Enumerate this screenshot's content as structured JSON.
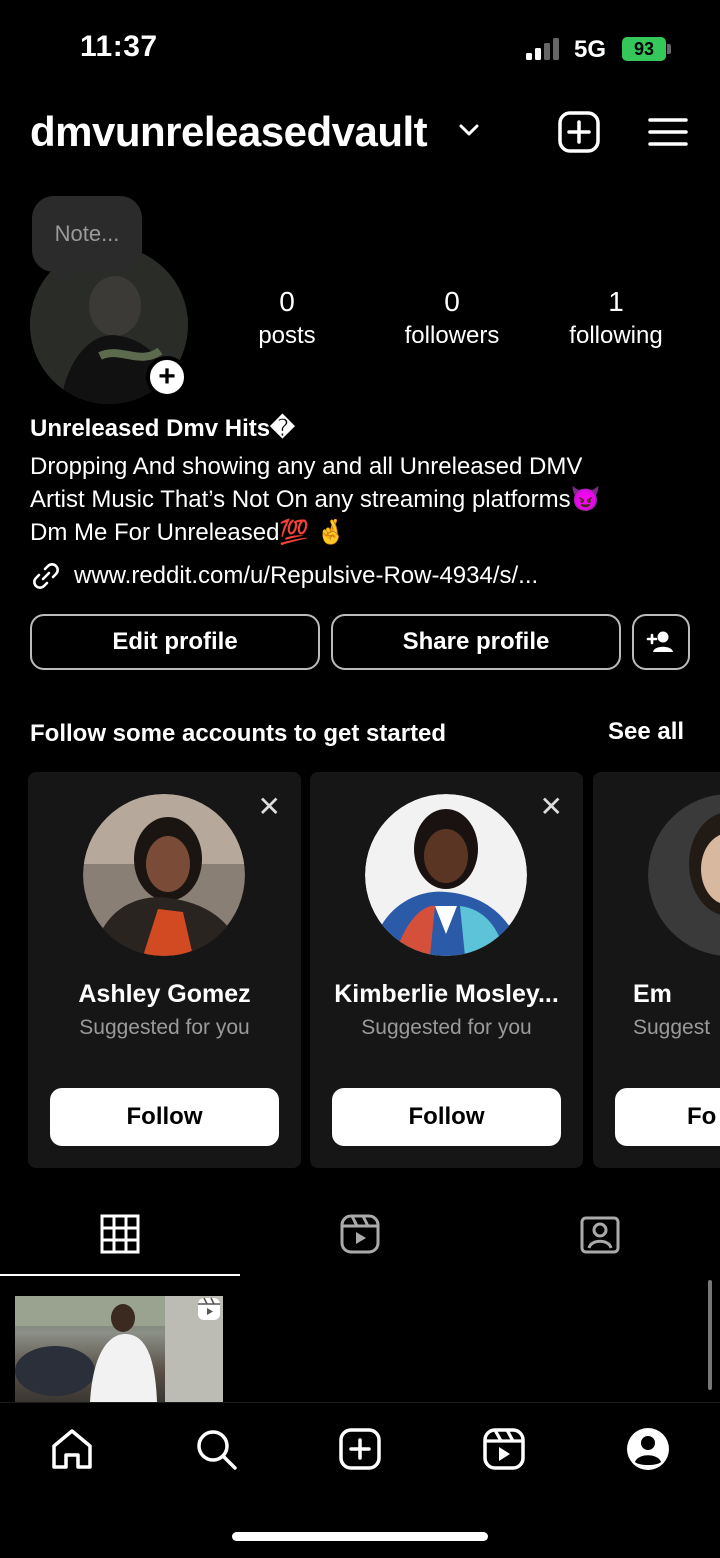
{
  "status_bar": {
    "time": "11:37",
    "network": "5G",
    "battery": "93"
  },
  "header": {
    "username": "dmvunreleasedvault"
  },
  "profile": {
    "note": "Note...",
    "stats": [
      {
        "value": "0",
        "label": "posts"
      },
      {
        "value": "0",
        "label": "followers"
      },
      {
        "value": "1",
        "label": "following"
      }
    ],
    "display_name": "Unreleased Dmv Hits�",
    "bio_lines": [
      "Dropping And showing any and all Unreleased DMV",
      "Artist Music That’s Not On any streaming platforms😈",
      "Dm Me For Unreleased💯 🤞"
    ],
    "link": "www.reddit.com/u/Repulsive-Row-4934/s/..."
  },
  "actions": {
    "edit_profile": "Edit profile",
    "share_profile": "Share profile"
  },
  "suggestions": {
    "title": "Follow some accounts to get started",
    "see_all": "See all",
    "cards": [
      {
        "name": "Ashley Gomez",
        "subtitle": "Suggested for you",
        "button": "Follow"
      },
      {
        "name": "Kimberlie Mosley...",
        "subtitle": "Suggested for you",
        "button": "Follow"
      },
      {
        "name": "Em",
        "subtitle": "Suggest",
        "button": "Fo"
      }
    ]
  },
  "tabs": [
    "grid-icon",
    "reels-icon",
    "tagged-icon"
  ],
  "bottom_nav": [
    "home-icon",
    "search-icon",
    "create-icon",
    "reels-icon",
    "profile-icon"
  ],
  "colors": {
    "battery": "#35c759",
    "background": "#000000",
    "card": "#161616"
  }
}
